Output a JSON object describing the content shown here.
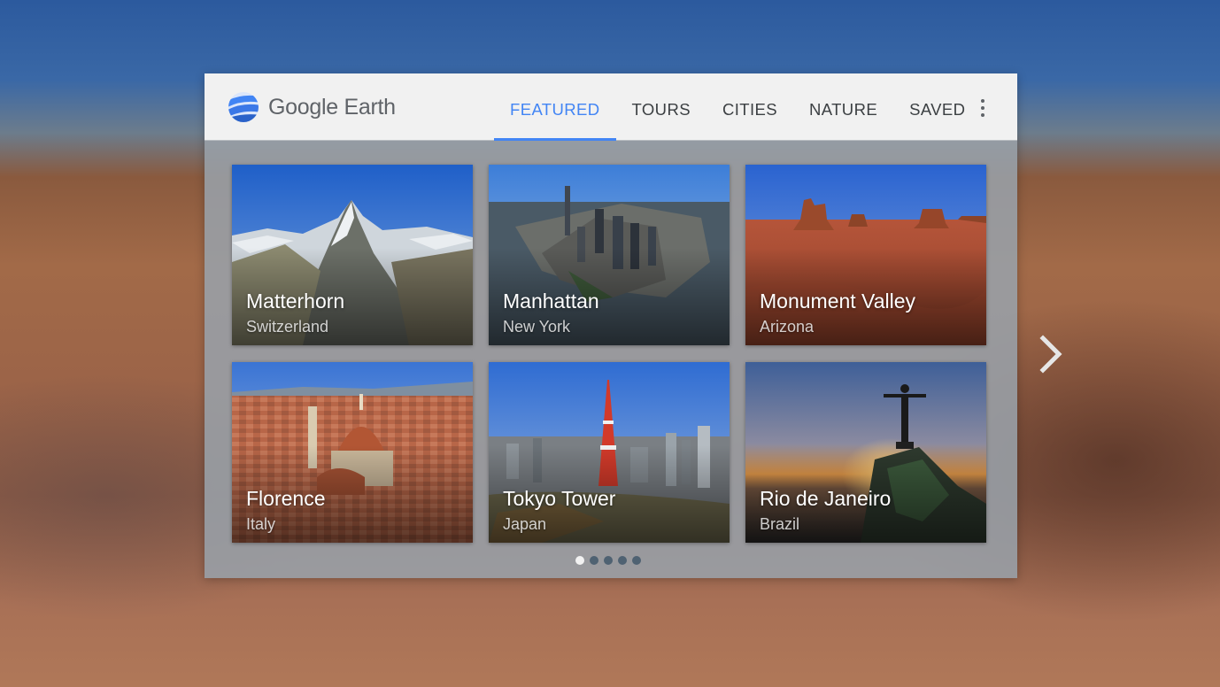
{
  "app": {
    "name": "Google Earth"
  },
  "tabs": [
    {
      "label": "FEATURED",
      "active": true
    },
    {
      "label": "TOURS",
      "active": false
    },
    {
      "label": "CITIES",
      "active": false
    },
    {
      "label": "NATURE",
      "active": false
    },
    {
      "label": "SAVED",
      "active": false
    }
  ],
  "cards": [
    {
      "title": "Matterhorn",
      "subtitle": "Switzerland"
    },
    {
      "title": "Manhattan",
      "subtitle": "New York"
    },
    {
      "title": "Monument Valley",
      "subtitle": "Arizona"
    },
    {
      "title": "Florence",
      "subtitle": "Italy"
    },
    {
      "title": "Tokyo Tower",
      "subtitle": "Japan"
    },
    {
      "title": "Rio de Janeiro",
      "subtitle": "Brazil"
    }
  ],
  "pagination": {
    "pages": 5,
    "current": 1
  },
  "icons": {
    "logo": "google-earth-logo-icon",
    "menu": "more-vert-icon",
    "next": "chevron-right-icon"
  },
  "colors": {
    "accent": "#4285f4",
    "header_bg": "#f1f1f1",
    "tab_text": "#3c4043"
  }
}
